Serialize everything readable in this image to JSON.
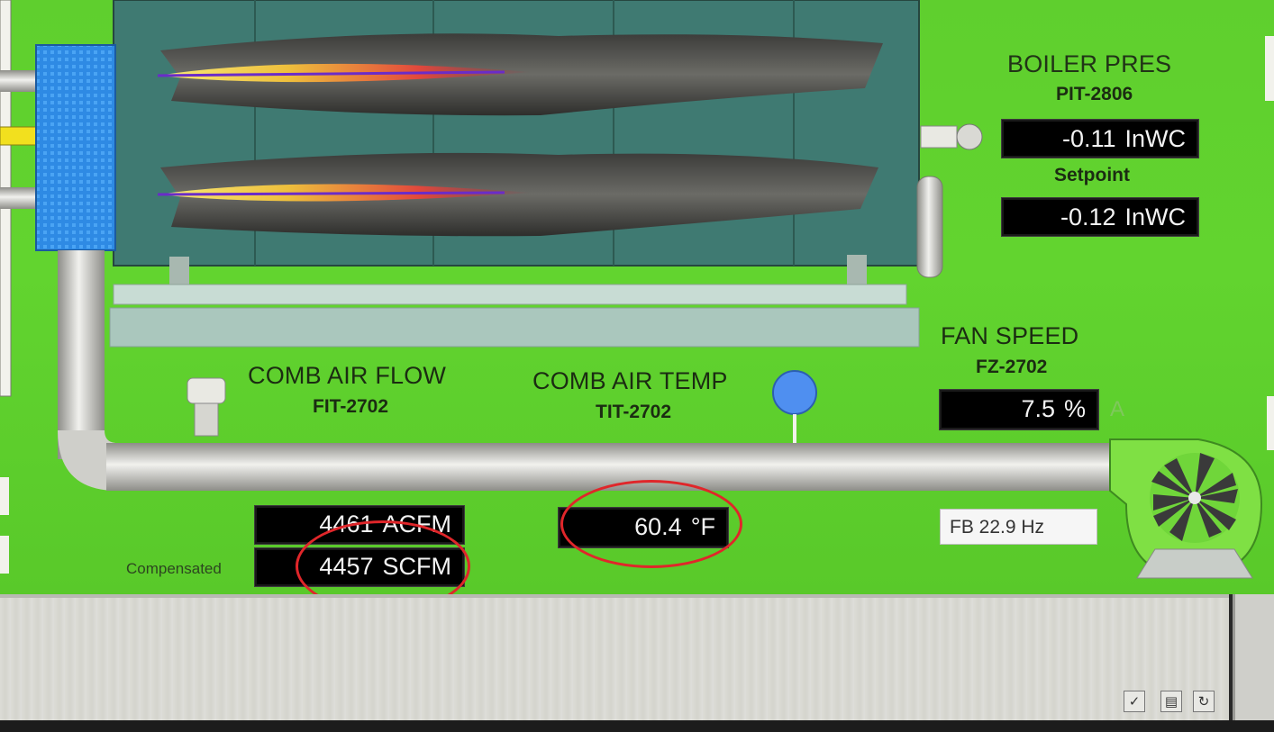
{
  "boiler": {
    "pressure_title": "BOILER PRES",
    "pressure_tag": "PIT-2806",
    "pressure_value": "-0.11",
    "pressure_unit": "InWC",
    "setpoint_label": "Setpoint",
    "setpoint_value": "-0.12",
    "setpoint_unit": "InWC"
  },
  "fan": {
    "title": "FAN SPEED",
    "tag": "FZ-2702",
    "value": "7.5",
    "unit": "%",
    "mode": "A",
    "feedback": "FB 22.9 Hz"
  },
  "air_flow": {
    "title": "COMB AIR FLOW",
    "tag": "FIT-2702",
    "actual_value": "4461",
    "actual_unit": "ACFM",
    "compensated_label": "Compensated",
    "standard_value": "4457",
    "standard_unit": "SCFM"
  },
  "air_temp": {
    "title": "COMB AIR TEMP",
    "tag": "TIT-2702",
    "value": "60.4",
    "unit": "°F"
  },
  "toolbar": {
    "ack_icon": "checkmark-icon",
    "print_icon": "print-icon",
    "refresh_icon": "refresh-icon",
    "ack_glyph": "✓",
    "print_glyph": "▤",
    "refresh_glyph": "↻"
  },
  "colors": {
    "background": "#5fcf2e",
    "readout_bg": "#000000",
    "readout_text": "#f3f3f3",
    "annotation": "#e0262a",
    "burner_flame": "#e8463a"
  }
}
